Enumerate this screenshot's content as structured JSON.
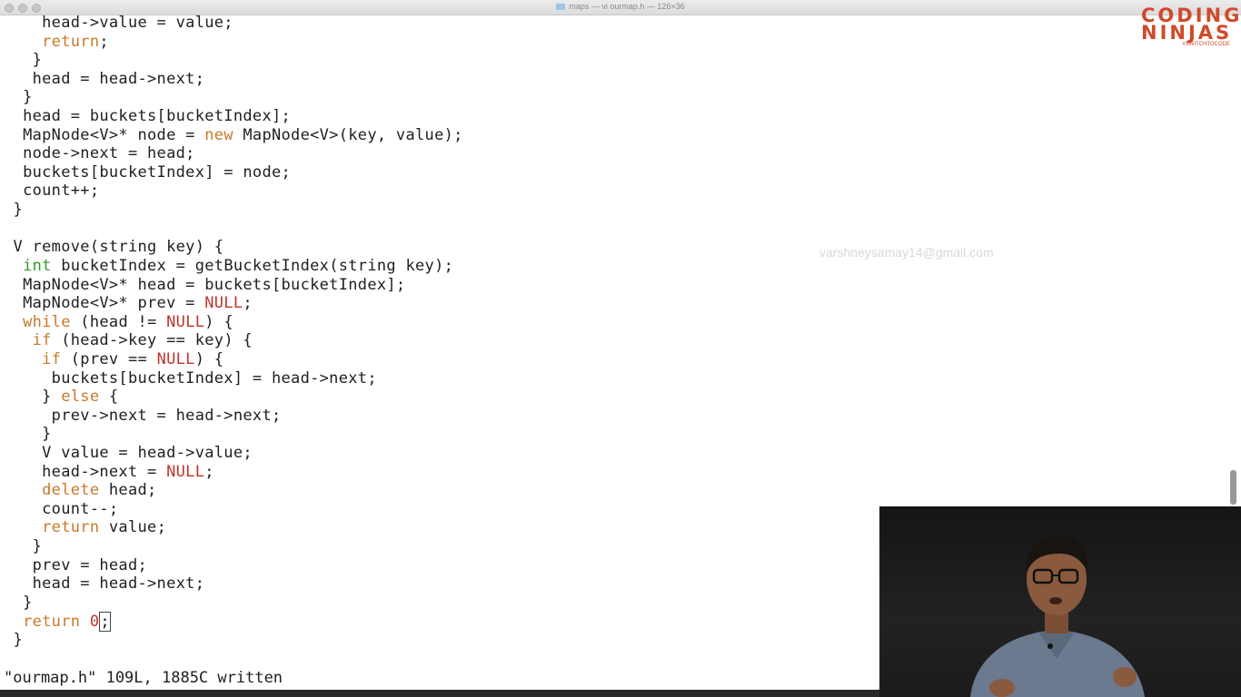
{
  "window": {
    "title": "maps — vi ourmap.h — 126×36"
  },
  "editor": {
    "lines": [
      [
        [
          "    head->value = value;",
          ""
        ]
      ],
      [
        [
          "    ",
          ""
        ],
        [
          "return",
          "kw"
        ],
        [
          ";",
          ""
        ]
      ],
      [
        [
          "   }",
          ""
        ]
      ],
      [
        [
          "   head = head->next;",
          ""
        ]
      ],
      [
        [
          "  }",
          ""
        ]
      ],
      [
        [
          "  head = buckets[bucketIndex];",
          ""
        ]
      ],
      [
        [
          "  MapNode<V>* node = ",
          ""
        ],
        [
          "new",
          "kw"
        ],
        [
          " MapNode<V>(key, value);",
          ""
        ]
      ],
      [
        [
          "  node->next = head;",
          ""
        ]
      ],
      [
        [
          "  buckets[bucketIndex] = node;",
          ""
        ]
      ],
      [
        [
          "  count++;",
          ""
        ]
      ],
      [
        [
          " }",
          ""
        ]
      ],
      [
        [
          "",
          ""
        ]
      ],
      [
        [
          " V remove(string key) {",
          ""
        ]
      ],
      [
        [
          "  ",
          ""
        ],
        [
          "int",
          "ty"
        ],
        [
          " bucketIndex = getBucketIndex(string key);",
          ""
        ]
      ],
      [
        [
          "  MapNode<V>* head = buckets[bucketIndex];",
          ""
        ]
      ],
      [
        [
          "  MapNode<V>* prev = ",
          ""
        ],
        [
          "NULL",
          "nu"
        ],
        [
          ";",
          ""
        ]
      ],
      [
        [
          "  ",
          ""
        ],
        [
          "while",
          "kw"
        ],
        [
          " (head != ",
          ""
        ],
        [
          "NULL",
          "nu"
        ],
        [
          ") {",
          ""
        ]
      ],
      [
        [
          "   ",
          ""
        ],
        [
          "if",
          "kw"
        ],
        [
          " (head->key == key) {",
          ""
        ]
      ],
      [
        [
          "    ",
          ""
        ],
        [
          "if",
          "kw"
        ],
        [
          " (prev == ",
          ""
        ],
        [
          "NULL",
          "nu"
        ],
        [
          ") {",
          ""
        ]
      ],
      [
        [
          "     buckets[bucketIndex] = head->next;",
          ""
        ]
      ],
      [
        [
          "    } ",
          ""
        ],
        [
          "else",
          "kw"
        ],
        [
          " {",
          ""
        ]
      ],
      [
        [
          "     prev->next = head->next;",
          ""
        ]
      ],
      [
        [
          "    }",
          ""
        ]
      ],
      [
        [
          "    V value = head->value;",
          ""
        ]
      ],
      [
        [
          "    head->next = ",
          ""
        ],
        [
          "NULL",
          "nu"
        ],
        [
          ";",
          ""
        ]
      ],
      [
        [
          "    ",
          ""
        ],
        [
          "delete",
          "kw"
        ],
        [
          " head;",
          ""
        ]
      ],
      [
        [
          "    count--;",
          ""
        ]
      ],
      [
        [
          "    ",
          ""
        ],
        [
          "return",
          "kw"
        ],
        [
          " value;",
          ""
        ]
      ],
      [
        [
          "   }",
          ""
        ]
      ],
      [
        [
          "   prev = head;",
          ""
        ]
      ],
      [
        [
          "   head = head->next;",
          ""
        ]
      ],
      [
        [
          "  }",
          ""
        ]
      ],
      [
        [
          "  ",
          ""
        ],
        [
          "return",
          "kw"
        ],
        [
          " ",
          ""
        ],
        [
          "0",
          "nu"
        ],
        [
          ";",
          "cursor"
        ]
      ],
      [
        [
          " }",
          ""
        ]
      ]
    ],
    "status_line": "\"ourmap.h\" 109L, 1885C written"
  },
  "branding": {
    "logo_text": "CODING NINJAS",
    "logo_tagline": "#SWITCHTOCODE",
    "watermark": "varshneysamay14@gmail.com"
  },
  "colors": {
    "keyword": "#c8792a",
    "type": "#2e9b2e",
    "number": "#c0342c",
    "logo": "#d04a2a"
  }
}
